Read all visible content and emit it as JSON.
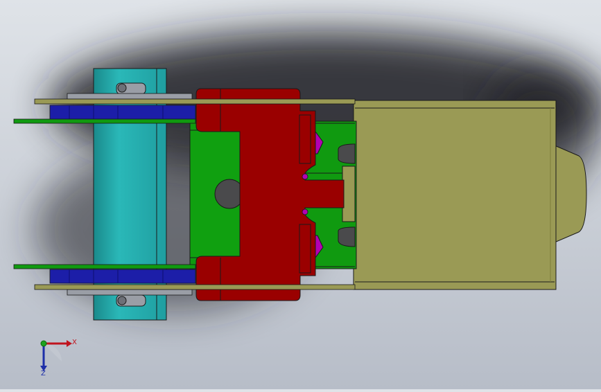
{
  "colors": {
    "background_top": "#dfe3e8",
    "background_bottom": "#b7bdc8",
    "shadow": "#1e1f22",
    "cylinder": "#23a9a9",
    "cylinder_shade": "#1a8a8b",
    "rail_blue": "#1c1ea8",
    "plate_green": "#109a10",
    "block_red": "#9a0000",
    "insert_magenta": "#b400b4",
    "housing_olive": "#9a9a55",
    "housing_edge": "#7d7d3c",
    "steel_grey": "#9a9ea6",
    "hole_grey": "#4a4a4c",
    "outline": "#1a1a1a",
    "triad_x": "#c0141e",
    "triad_y": "#1fa21f",
    "triad_z": "#1e2fa8"
  },
  "triad": {
    "x_label": "X",
    "z_label": "Z"
  }
}
